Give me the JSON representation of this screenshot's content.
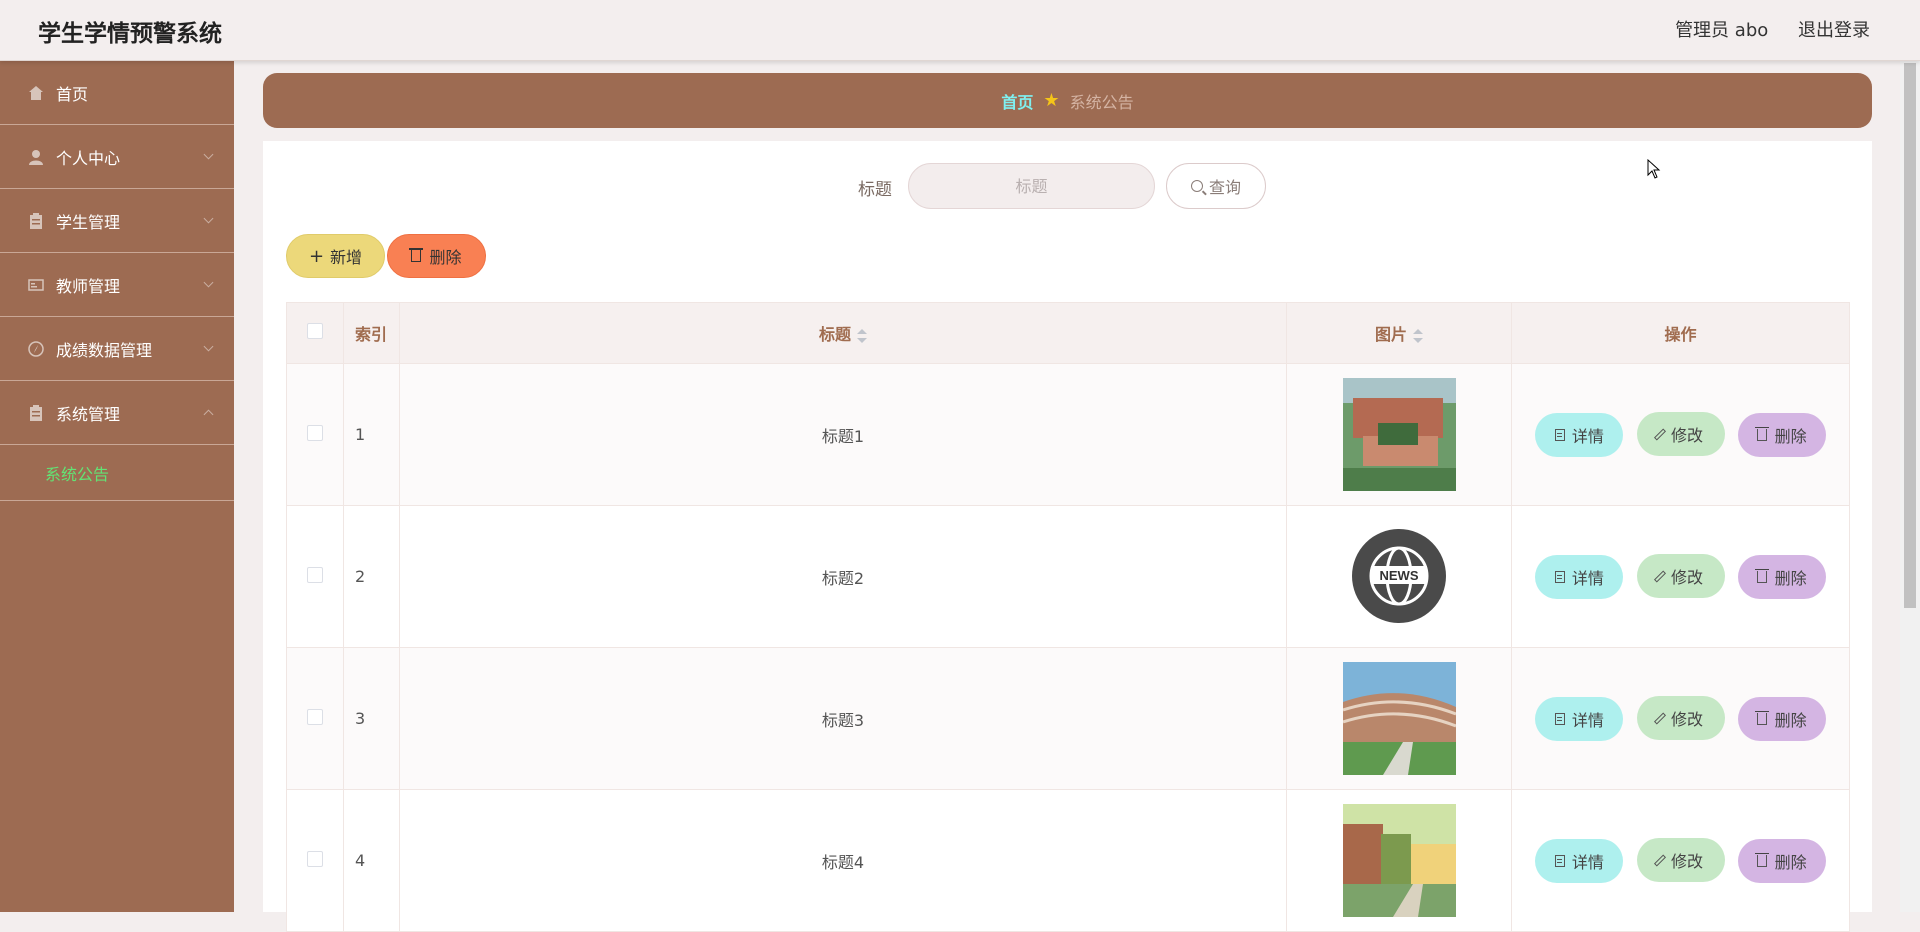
{
  "app": {
    "title": "学生学情预警系统"
  },
  "header": {
    "user_label": "管理员 abo",
    "logout_label": "退出登录"
  },
  "sidebar": {
    "items": [
      {
        "label": "首页",
        "icon": "home-icon"
      },
      {
        "label": "个人中心",
        "icon": "user-icon"
      },
      {
        "label": "学生管理",
        "icon": "clipboard-icon"
      },
      {
        "label": "教师管理",
        "icon": "id-card-icon"
      },
      {
        "label": "成绩数据管理",
        "icon": "compass-icon"
      },
      {
        "label": "系统管理",
        "icon": "clipboard-icon",
        "expanded": true
      }
    ],
    "submenu_active": "系统公告"
  },
  "breadcrumb": {
    "home": "首页",
    "current": "系统公告"
  },
  "search": {
    "label": "标题",
    "placeholder": "标题",
    "button_label": "查询"
  },
  "actions": {
    "add_label": "新增",
    "delete_label": "删除"
  },
  "table": {
    "columns": {
      "index": "索引",
      "title": "标题",
      "image": "图片",
      "ops": "操作"
    },
    "rows": [
      {
        "index": "1",
        "title": "标题1",
        "image": "campus-aerial"
      },
      {
        "index": "2",
        "title": "标题2",
        "image": "news-globe"
      },
      {
        "index": "3",
        "title": "标题3",
        "image": "campus-curved-building"
      },
      {
        "index": "4",
        "title": "标题4",
        "image": "campus-sunset"
      }
    ],
    "op_labels": {
      "detail": "详情",
      "edit": "修改",
      "delete": "删除"
    }
  },
  "colors": {
    "sidebar_bg": "#9d6b52",
    "accent_home": "#7ff0f0",
    "submenu_active": "#63e374",
    "add_btn": "#ecd87a",
    "delete_btn": "#f98053"
  }
}
